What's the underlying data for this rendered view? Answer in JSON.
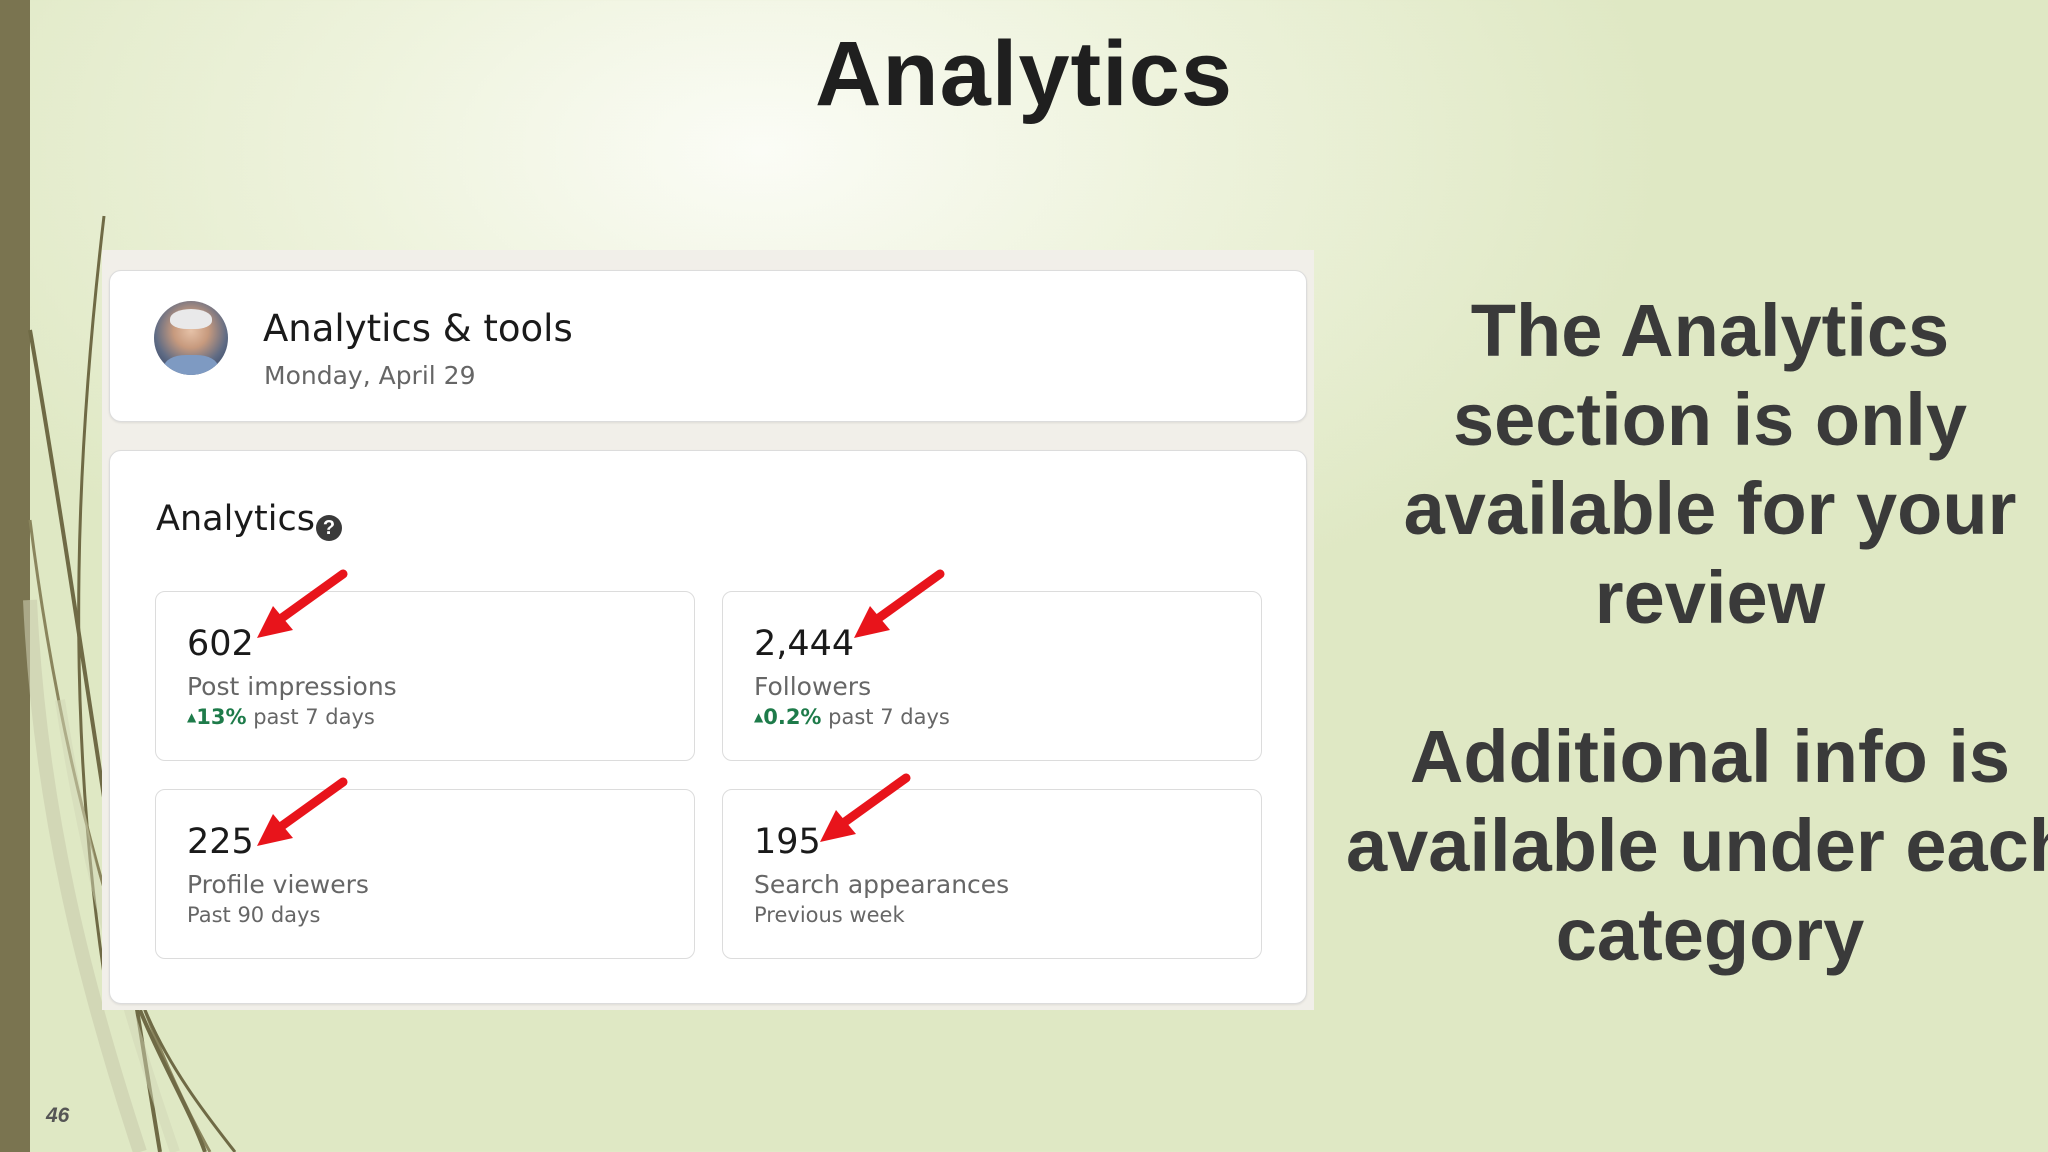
{
  "slide": {
    "title": "Analytics",
    "page_number": "46",
    "note_1": "The Analytics section is only available for your review",
    "note_2": "Additional info is available under each category"
  },
  "profile_card": {
    "title": "Analytics & tools",
    "date": "Monday, April 29"
  },
  "analytics": {
    "heading": "Analytics",
    "help_icon": "question-circle-icon",
    "tiles": [
      {
        "value": "602",
        "label": "Post impressions",
        "change": "13%",
        "period": "past 7 days"
      },
      {
        "value": "2,444",
        "label": "Followers",
        "change": "0.2%",
        "period": "past 7 days"
      },
      {
        "value": "225",
        "label": "Profile viewers",
        "period": "Past 90 days"
      },
      {
        "value": "195",
        "label": "Search appearances",
        "period": "Previous week"
      }
    ]
  },
  "colors": {
    "accent_bar": "#7a7450",
    "positive_change": "#1e7b4a",
    "arrow": "#e8141b"
  }
}
